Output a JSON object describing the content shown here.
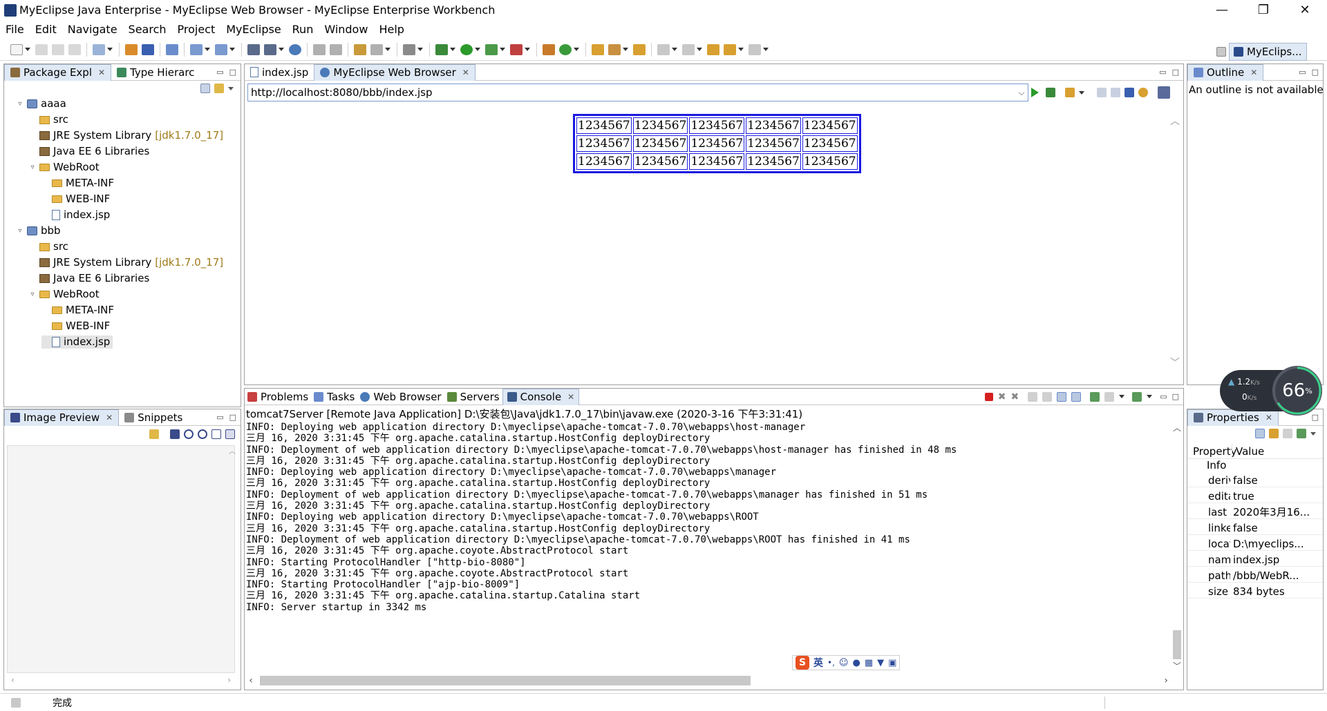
{
  "window": {
    "title": "MyEclipse Java Enterprise - MyEclipse Web Browser - MyEclipse Enterprise Workbench",
    "minimize": "—",
    "restore": "❐",
    "close": "✕"
  },
  "menu": [
    "File",
    "Edit",
    "Navigate",
    "Search",
    "Project",
    "MyEclipse",
    "Run",
    "Window",
    "Help"
  ],
  "perspective": {
    "label": "MyEclips..."
  },
  "explorer": {
    "tabs": [
      {
        "label": "Package Expl",
        "close": "✕"
      },
      {
        "label": "Type Hierarc"
      }
    ],
    "items": [
      {
        "label": "aaaa",
        "decor": "",
        "icon": "project-icon",
        "twisty": "▿"
      },
      {
        "label": "src",
        "decor": "",
        "icon": "source-folder-icon",
        "twisty": ""
      },
      {
        "label": "JRE System Library",
        "decor": "[jdk1.7.0_17]",
        "icon": "library-icon",
        "twisty": ""
      },
      {
        "label": "Java EE 6 Libraries",
        "decor": "",
        "icon": "library-icon",
        "twisty": ""
      },
      {
        "label": "WebRoot",
        "decor": "",
        "icon": "folder-icon",
        "twisty": "▿"
      },
      {
        "label": "META-INF",
        "decor": "",
        "icon": "folder-icon",
        "twisty": ""
      },
      {
        "label": "WEB-INF",
        "decor": "",
        "icon": "folder-icon",
        "twisty": ""
      },
      {
        "label": "index.jsp",
        "decor": "",
        "icon": "jsp-file-icon",
        "twisty": ""
      },
      {
        "label": "bbb",
        "decor": "",
        "icon": "project-icon",
        "twisty": "▿"
      },
      {
        "label": "src",
        "decor": "",
        "icon": "source-folder-icon",
        "twisty": ""
      },
      {
        "label": "JRE System Library",
        "decor": "[jdk1.7.0_17]",
        "icon": "library-icon",
        "twisty": ""
      },
      {
        "label": "Java EE 6 Libraries",
        "decor": "",
        "icon": "library-icon",
        "twisty": ""
      },
      {
        "label": "WebRoot",
        "decor": "",
        "icon": "folder-icon",
        "twisty": "▿"
      },
      {
        "label": "META-INF",
        "decor": "",
        "icon": "folder-icon",
        "twisty": ""
      },
      {
        "label": "WEB-INF",
        "decor": "",
        "icon": "folder-icon",
        "twisty": ""
      },
      {
        "label": "index.jsp",
        "decor": "",
        "icon": "jsp-file-icon",
        "twisty": ""
      }
    ]
  },
  "image_panel": {
    "tabs": [
      {
        "label": "Image Preview",
        "close": "✕"
      },
      {
        "label": "Snippets"
      }
    ]
  },
  "editor": {
    "tabs": [
      {
        "label": "index.jsp"
      },
      {
        "label": "MyEclipse Web Browser",
        "close": "✕"
      }
    ],
    "url": "http://localhost:8080/bbb/index.jsp",
    "table": [
      [
        "1234567",
        "1234567",
        "1234567",
        "1234567",
        "1234567"
      ],
      [
        "1234567",
        "1234567",
        "1234567",
        "1234567",
        "1234567"
      ],
      [
        "1234567",
        "1234567",
        "1234567",
        "1234567",
        "1234567"
      ]
    ]
  },
  "outline": {
    "tab": "Outline",
    "close": "✕",
    "message": "An outline is not available."
  },
  "bottom": {
    "tabs": [
      {
        "label": "Problems"
      },
      {
        "label": "Tasks"
      },
      {
        "label": "Web Browser"
      },
      {
        "label": "Servers"
      },
      {
        "label": "Console",
        "close": "✕"
      }
    ],
    "console_header": "tomcat7Server [Remote Java Application] D:\\安装包\\Java\\jdk1.7.0_17\\bin\\javaw.exe (2020-3-16 下午3:31:41)",
    "console_lines": [
      "INFO: Deploying web application directory D:\\myeclipse\\apache-tomcat-7.0.70\\webapps\\host-manager",
      "三月 16, 2020 3:31:45 下午 org.apache.catalina.startup.HostConfig deployDirectory",
      "INFO: Deployment of web application directory D:\\myeclipse\\apache-tomcat-7.0.70\\webapps\\host-manager has finished in 48 ms",
      "三月 16, 2020 3:31:45 下午 org.apache.catalina.startup.HostConfig deployDirectory",
      "INFO: Deploying web application directory D:\\myeclipse\\apache-tomcat-7.0.70\\webapps\\manager",
      "三月 16, 2020 3:31:45 下午 org.apache.catalina.startup.HostConfig deployDirectory",
      "INFO: Deployment of web application directory D:\\myeclipse\\apache-tomcat-7.0.70\\webapps\\manager has finished in 51 ms",
      "三月 16, 2020 3:31:45 下午 org.apache.catalina.startup.HostConfig deployDirectory",
      "INFO: Deploying web application directory D:\\myeclipse\\apache-tomcat-7.0.70\\webapps\\ROOT",
      "三月 16, 2020 3:31:45 下午 org.apache.catalina.startup.HostConfig deployDirectory",
      "INFO: Deployment of web application directory D:\\myeclipse\\apache-tomcat-7.0.70\\webapps\\ROOT has finished in 41 ms",
      "三月 16, 2020 3:31:45 下午 org.apache.coyote.AbstractProtocol start",
      "INFO: Starting ProtocolHandler [\"http-bio-8080\"]",
      "三月 16, 2020 3:31:45 下午 org.apache.coyote.AbstractProtocol start",
      "INFO: Starting ProtocolHandler [\"ajp-bio-8009\"]",
      "三月 16, 2020 3:31:45 下午 org.apache.catalina.startup.Catalina start",
      "INFO: Server startup in 3342 ms"
    ]
  },
  "properties": {
    "tab": "Properties",
    "close": "✕",
    "header": {
      "property": "Property",
      "value": "Value"
    },
    "group": "Info",
    "rows": [
      {
        "key": "deriv",
        "value": "false"
      },
      {
        "key": "edita",
        "value": "true"
      },
      {
        "key": "last r",
        "value": "2020年3月16..."
      },
      {
        "key": "linke",
        "value": "false"
      },
      {
        "key": "locat",
        "value": "D:\\myeclips..."
      },
      {
        "key": "nam",
        "value": "index.jsp"
      },
      {
        "key": "path",
        "value": "/bbb/WebR..."
      },
      {
        "key": "size",
        "value": "834  bytes"
      }
    ]
  },
  "network_widget": {
    "up": "1.2",
    "down": "0",
    "unit": "K/s",
    "percent": "66",
    "percent_sign": "%"
  },
  "ime": {
    "label": "英"
  },
  "status": {
    "text": "完成"
  },
  "colors": {
    "accent": "#dfe9f5",
    "table_border": "#1a1ae0",
    "stop_red": "#d42020",
    "run_green": "#2a9a2a"
  }
}
